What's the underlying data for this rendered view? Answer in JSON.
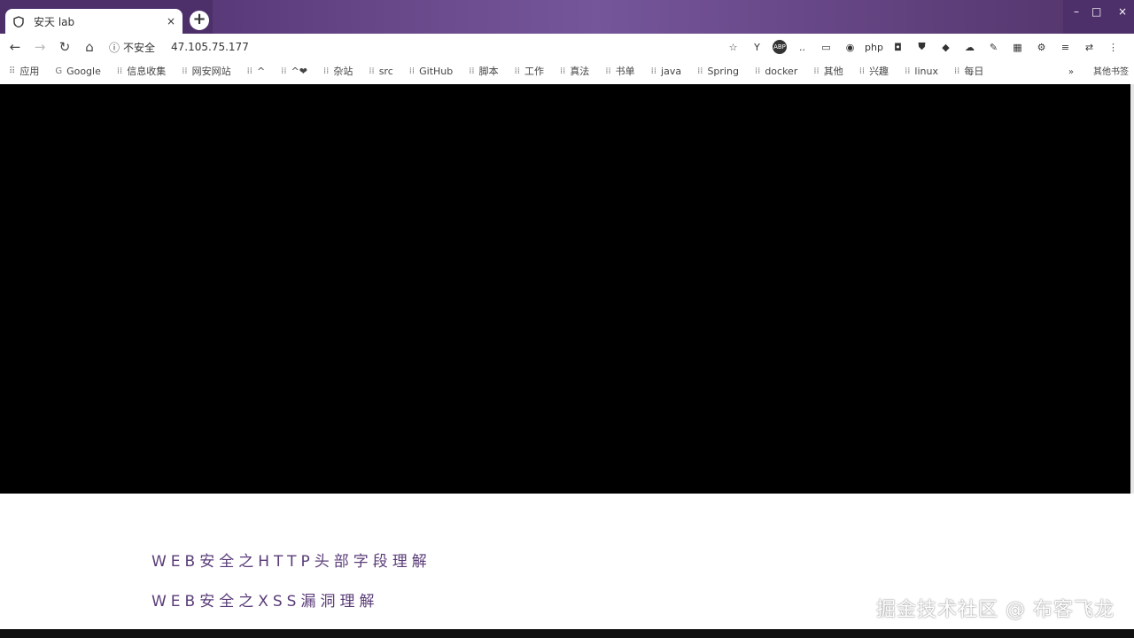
{
  "browser": {
    "tab_title": "安天 lab",
    "tab_close": "×",
    "new_tab": "+",
    "window_controls": {
      "minimize": "–",
      "maximize": "□",
      "close": "×"
    }
  },
  "toolbar": {
    "security_label": "不安全",
    "url": "47.105.75.177"
  },
  "extensions": [
    "Y",
    "ABP",
    "..",
    "php"
  ],
  "bookmarks": [
    {
      "label": "应用",
      "icon": "apps-icon"
    },
    {
      "label": "Google",
      "icon": "google-icon"
    },
    {
      "label": "信息收集",
      "icon": "folder-icon"
    },
    {
      "label": "网安网站",
      "icon": "folder-icon"
    },
    {
      "label": "^",
      "icon": "folder-icon"
    },
    {
      "label": "^❤",
      "icon": "folder-icon"
    },
    {
      "label": "杂站",
      "icon": "folder-icon"
    },
    {
      "label": "src",
      "icon": "folder-icon"
    },
    {
      "label": "GitHub",
      "icon": "folder-icon"
    },
    {
      "label": "脚本",
      "icon": "folder-icon"
    },
    {
      "label": "工作",
      "icon": "folder-icon"
    },
    {
      "label": "真法",
      "icon": "folder-icon"
    },
    {
      "label": "书单",
      "icon": "folder-icon"
    },
    {
      "label": "java",
      "icon": "folder-icon"
    },
    {
      "label": "Spring",
      "icon": "folder-icon"
    },
    {
      "label": "docker",
      "icon": "folder-icon"
    },
    {
      "label": "其他",
      "icon": "folder-icon"
    },
    {
      "label": "兴趣",
      "icon": "folder-icon"
    },
    {
      "label": "linux",
      "icon": "folder-icon"
    },
    {
      "label": "每日",
      "icon": "folder-icon"
    }
  ],
  "bookmarks_more": "»",
  "other_bookmarks": "其他书签",
  "articles": [
    {
      "title": "WEB安全之HTTP头部字段理解"
    },
    {
      "title": "WEB安全之XSS漏洞理解"
    }
  ],
  "watermark": "掘金技术社区 @ 布客飞龙",
  "colors": {
    "titlebar": "#4d2f6a",
    "link": "#5a3c78",
    "video_bg": "#000000"
  }
}
